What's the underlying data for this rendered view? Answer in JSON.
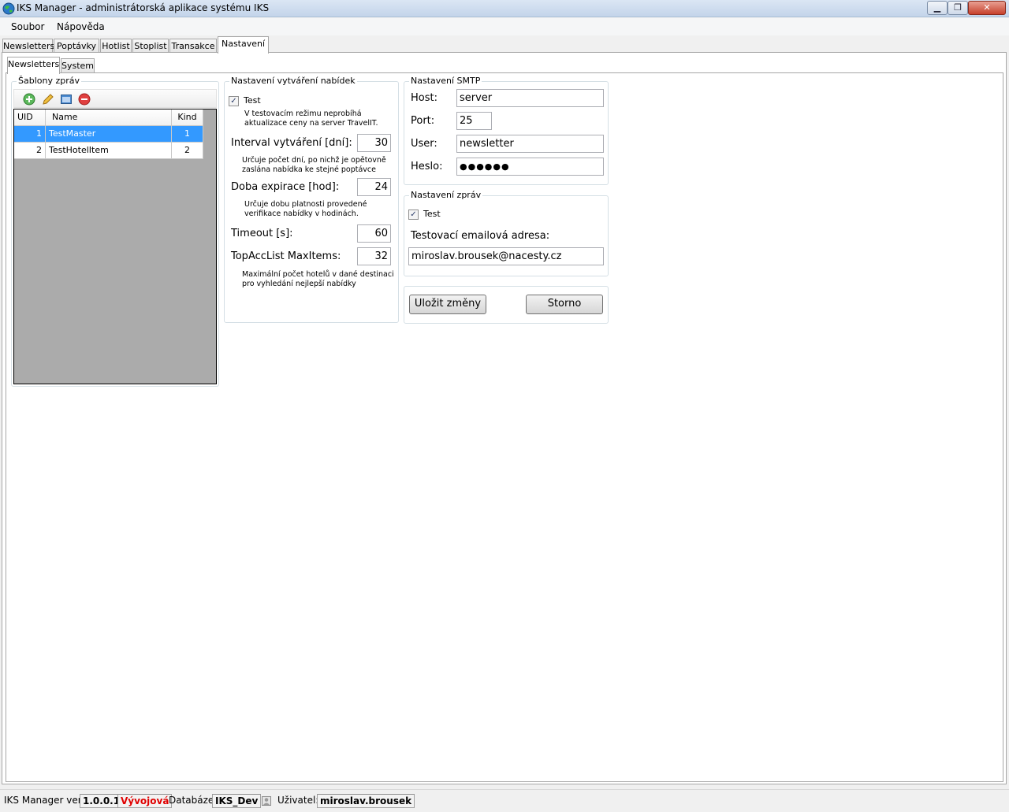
{
  "window": {
    "title": "IKS Manager - administrátorská aplikace systému IKS",
    "controls": {
      "minimize": "▁",
      "maximize": "❐",
      "close": "✕"
    }
  },
  "menu": [
    "Soubor",
    "Nápověda"
  ],
  "main_tabs": [
    "Newsletters",
    "Poptávky",
    "Hotlist",
    "Stoplist",
    "Transakce",
    "Nastavení"
  ],
  "sub_tabs": [
    "Newsletters",
    "System"
  ],
  "templates": {
    "title": "Šablony zpráv",
    "toolbar_icons": [
      "add-icon",
      "edit-icon",
      "view-icon",
      "delete-icon"
    ],
    "columns": [
      "UID",
      "Name",
      "Kind"
    ],
    "rows": [
      {
        "uid": "1",
        "name": "TestMaster",
        "kind": "1"
      },
      {
        "uid": "2",
        "name": "TestHotelItem",
        "kind": "2"
      }
    ]
  },
  "offers": {
    "title": "Nastavení vytváření nabídek",
    "test_label": "Test",
    "test_checked": true,
    "test_desc": [
      "V testovacím režimu neprobíhá",
      "aktualizace ceny na server TravelIT."
    ],
    "interval_label": "Interval vytváření [dní]:",
    "interval_value": "30",
    "interval_desc": [
      "Určuje počet dní, po nichž je opětovně",
      "zaslána nabídka ke stejné poptávce"
    ],
    "expiry_label": "Doba expirace [hod]:",
    "expiry_value": "24",
    "expiry_desc": [
      "Určuje dobu platnosti provedené",
      "verifikace nabídky v hodinách."
    ],
    "timeout_label": "Timeout [s]:",
    "timeout_value": "60",
    "maxitems_label": "TopAccList MaxItems:",
    "maxitems_value": "32",
    "maxitems_desc": [
      "Maximální počet hotelů v dané destinaci",
      "pro vyhledání nejlepší nabídky"
    ]
  },
  "smtp": {
    "title": "Nastavení SMTP",
    "host_label": "Host:",
    "host_value": "server",
    "port_label": "Port:",
    "port_value": "25",
    "user_label": "User:",
    "user_value": "newsletter",
    "password_label": "Heslo:",
    "password_value": "●●●●●●"
  },
  "messages": {
    "title": "Nastavení zpráv",
    "test_label": "Test",
    "test_checked": true,
    "email_label": "Testovací emailová adresa:",
    "email_value": "miroslav.brousek@nacesty.cz"
  },
  "actions": {
    "save": "Uložit změny",
    "cancel": "Storno"
  },
  "status": {
    "version_label": "IKS Manager ver.:",
    "version": "1.0.0.1",
    "env": "Vývojová",
    "env_color": "#e00000",
    "db_label": "Databáze:",
    "db": "IKS_Dev",
    "user_label": "Uživatel:",
    "user": "miroslav.brousek"
  }
}
